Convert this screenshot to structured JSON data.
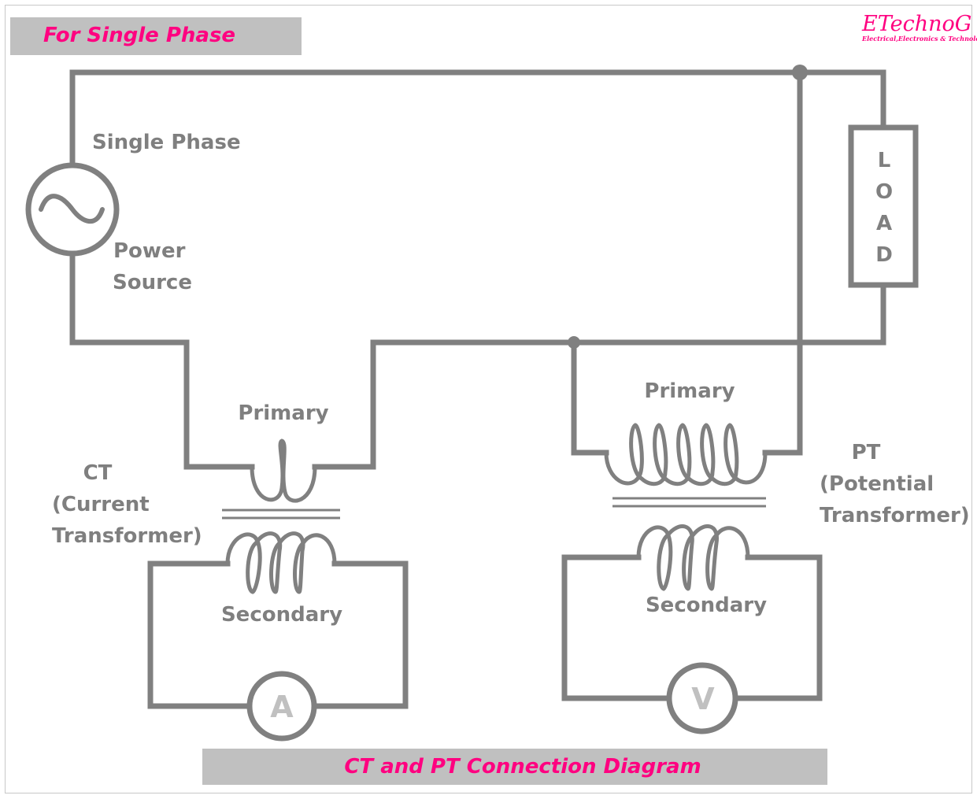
{
  "header": {
    "banner_title": "For Single Phase",
    "banner_color": "#c0c0c0",
    "accent_color": "#ff0080"
  },
  "logo": {
    "brand": "ETechnoG",
    "tagline": "Electrical,Electronics & Technology"
  },
  "source": {
    "label_top": "Single Phase",
    "label_line1": "Power",
    "label_line2": "Source",
    "icon": "ac-source-icon"
  },
  "load": {
    "letters": [
      "L",
      "O",
      "A",
      "D"
    ]
  },
  "ct": {
    "title_line1": "CT",
    "title_line2": "(Current",
    "title_line3": "Transformer)",
    "primary_label": "Primary",
    "secondary_label": "Secondary",
    "meter_symbol": "A"
  },
  "pt": {
    "title_line1": "PT",
    "title_line2": "(Potential",
    "title_line3": "Transformer)",
    "primary_label": "Primary",
    "secondary_label": "Secondary",
    "meter_symbol": "V"
  },
  "footer": {
    "caption": "CT and PT Connection Diagram"
  },
  "colors": {
    "wire": "#808080",
    "label": "#7f7f7f",
    "meter_symbol": "#c0c0c0"
  }
}
